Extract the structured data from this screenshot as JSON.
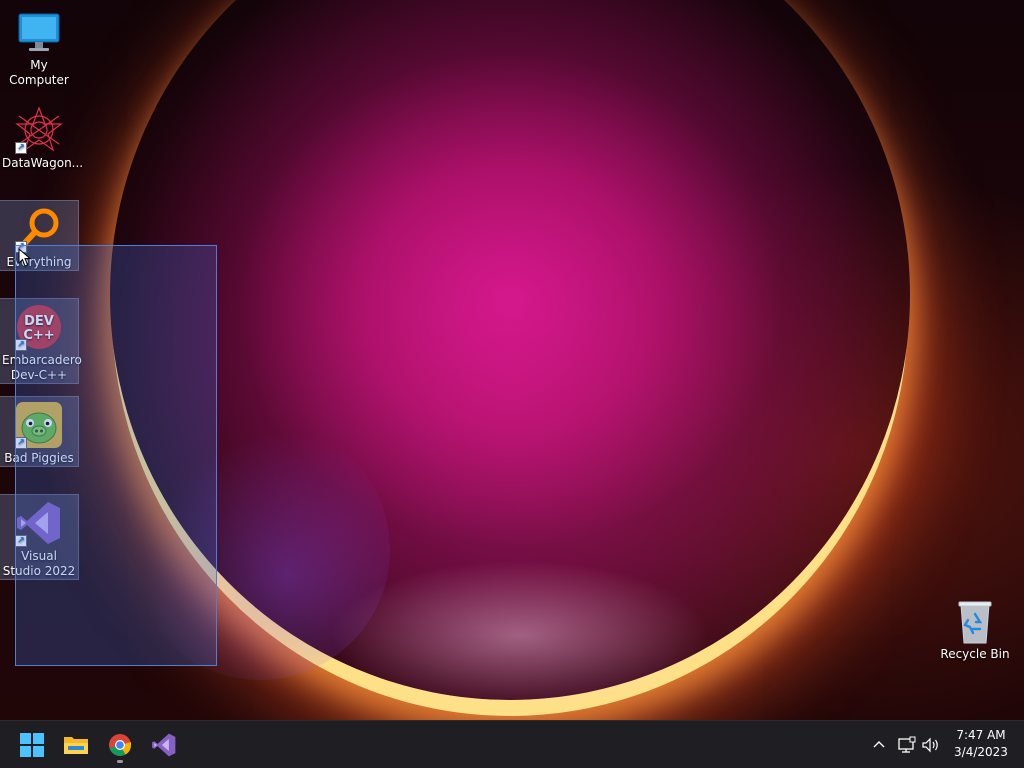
{
  "desktop": {
    "icons": [
      {
        "label": "My Computer",
        "icon": "monitor-icon",
        "shortcut": false
      },
      {
        "label": "DataWagon...",
        "icon": "datawagon-icon",
        "shortcut": true
      },
      {
        "label": "Everything",
        "icon": "everything-search-icon",
        "shortcut": true
      },
      {
        "label": "Embarcadero Dev-C++",
        "icon": "devcpp-icon",
        "shortcut": true,
        "icon_text": "DEV C++"
      },
      {
        "label": "Bad Piggies",
        "icon": "bad-piggies-icon",
        "shortcut": true
      },
      {
        "label": "Visual Studio 2022",
        "icon": "visual-studio-icon",
        "shortcut": true
      },
      {
        "label": "Recycle Bin",
        "icon": "recycle-bin-icon",
        "shortcut": false
      }
    ]
  },
  "taskbar": {
    "apps": [
      {
        "name": "Start",
        "icon": "windows-start-icon"
      },
      {
        "name": "File Explorer",
        "icon": "file-explorer-icon"
      },
      {
        "name": "Google Chrome",
        "icon": "chrome-icon",
        "running": true
      },
      {
        "name": "Visual Studio",
        "icon": "visual-studio-icon"
      }
    ],
    "tray": {
      "icons": [
        "chevron-up-icon",
        "network-icon",
        "volume-icon"
      ],
      "time": "7:47 AM",
      "date": "3/4/2023"
    }
  },
  "colors": {
    "taskbar_bg": "#1f1e22",
    "selection_fill": "#3c6edc",
    "selection_border": "#4c7fd8"
  }
}
